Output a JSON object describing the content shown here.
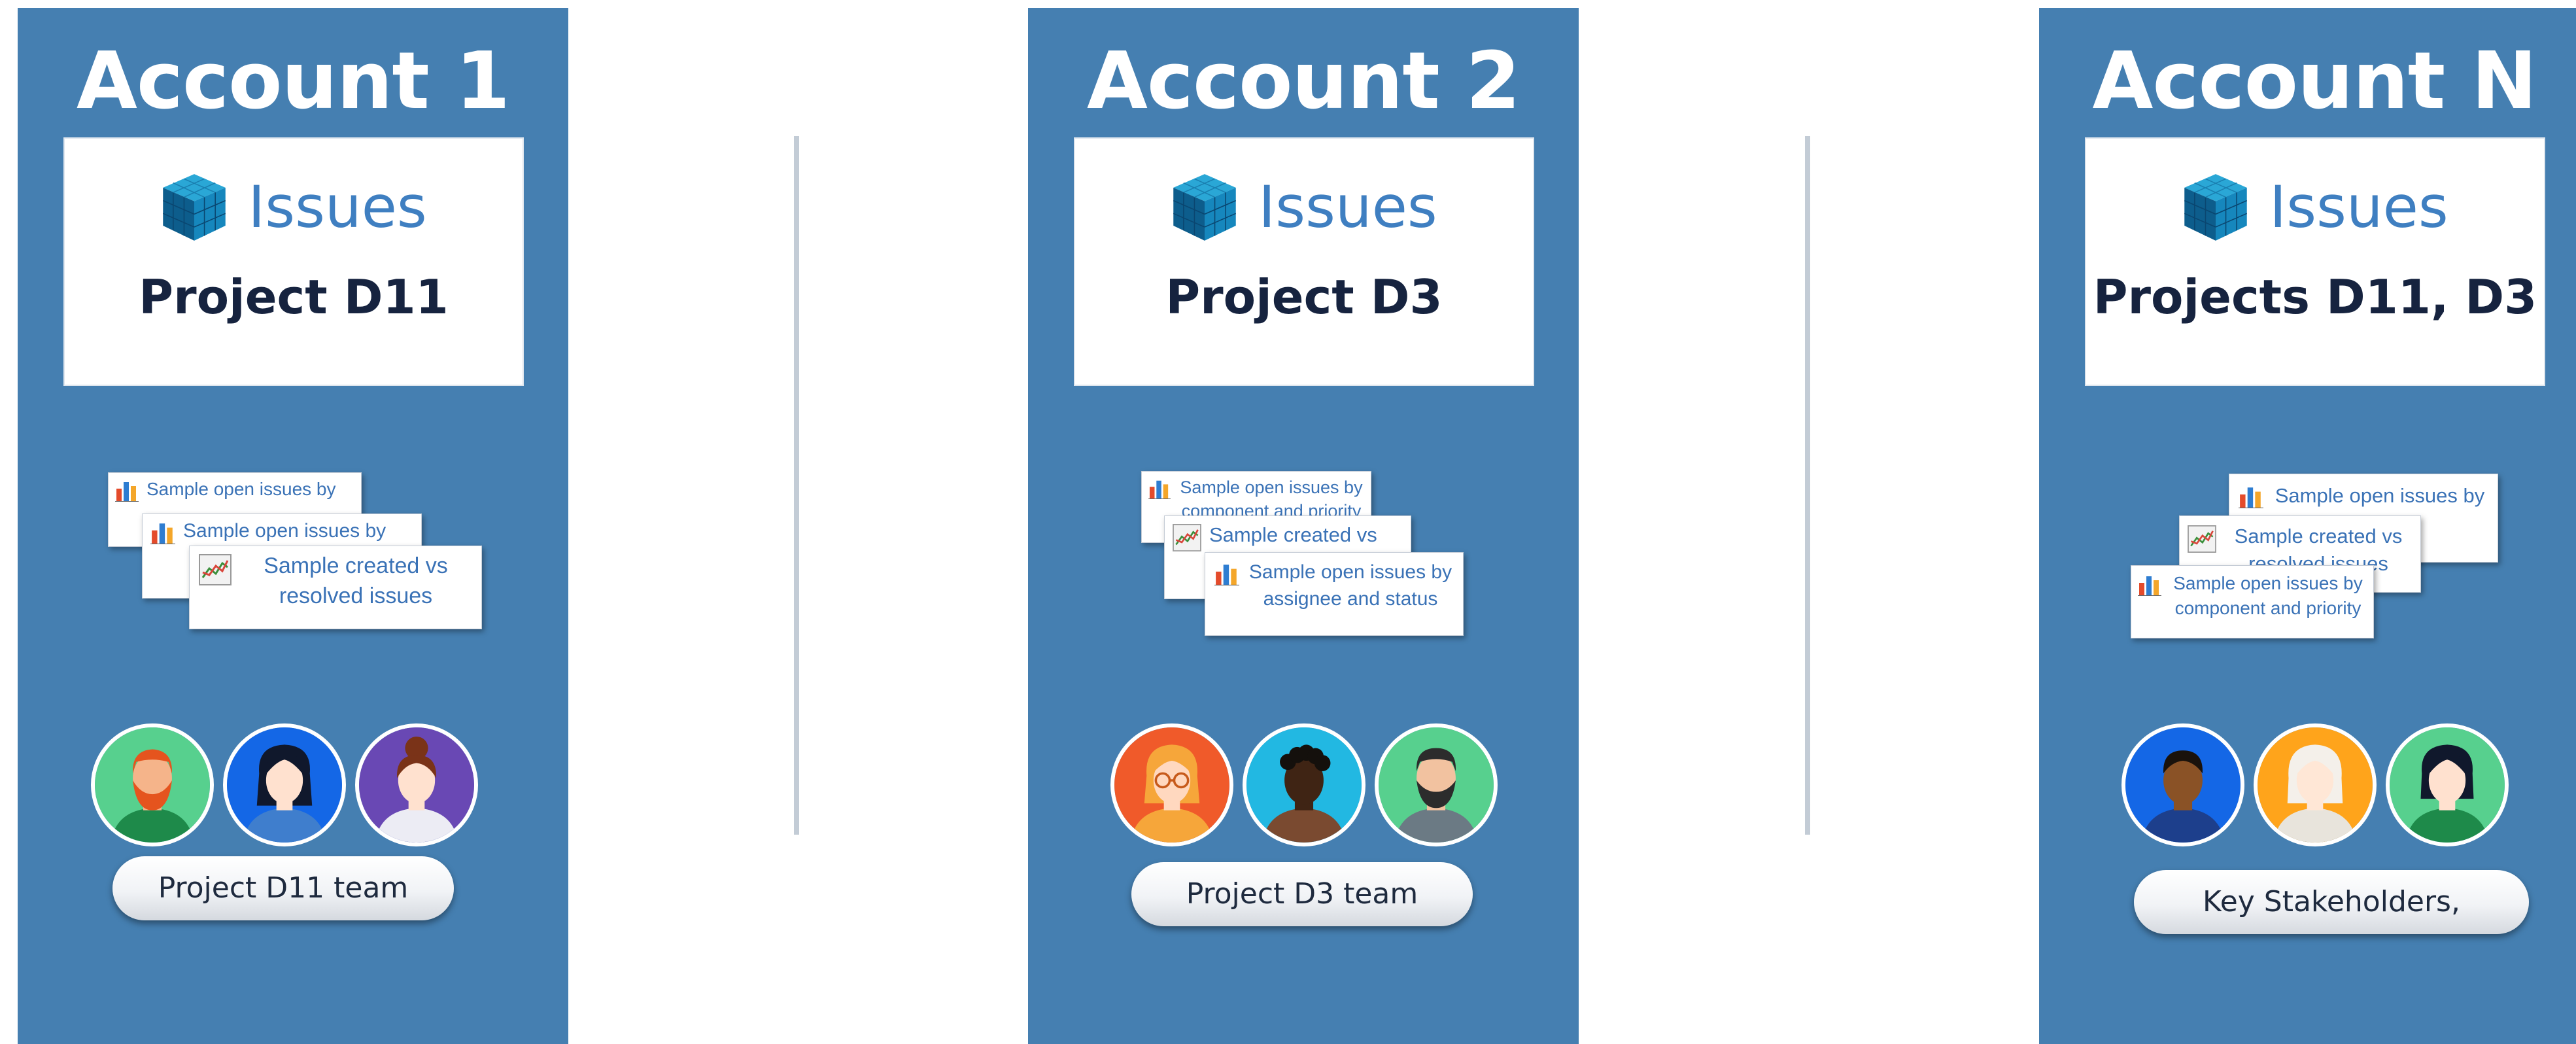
{
  "accounts": [
    {
      "title": "Account 1",
      "issues_label": "Issues",
      "project": "Project D11",
      "gadgets": [
        {
          "text": "Sample open issues by",
          "icon": "bar-chart-icon"
        },
        {
          "text": "Sample open issues by",
          "icon": "bar-chart-icon"
        },
        {
          "text": "Sample created vs resolved issues",
          "icon": "line-chart-icon"
        }
      ],
      "team_label": "Project D11 team",
      "avatars": [
        {
          "name": "avatar-red-bearded-man",
          "bg": "#57d08e",
          "skin": "#f5b48a",
          "hair": "#e5541e",
          "shirt": "#1e8a4a"
        },
        {
          "name": "avatar-dark-haired-woman",
          "bg": "#1467e6",
          "skin": "#ffe1cf",
          "hair": "#10182c",
          "shirt": "#3f7ecd"
        },
        {
          "name": "avatar-bun-haired-woman",
          "bg": "#6948b4",
          "skin": "#ffe1cf",
          "hair": "#7a3318",
          "shirt": "#ececf4"
        }
      ]
    },
    {
      "title": "Account 2",
      "issues_label": "Issues",
      "project": "Project D3",
      "gadgets": [
        {
          "text": "Sample open issues by component and priority",
          "icon": "bar-chart-icon"
        },
        {
          "text": "Sample created vs",
          "icon": "line-chart-icon"
        },
        {
          "text": "Sample open issues by assignee and status",
          "icon": "bar-chart-icon"
        }
      ],
      "team_label": "Project D3 team",
      "avatars": [
        {
          "name": "avatar-woman-glasses",
          "bg": "#f05a2a",
          "skin": "#ffd8bf",
          "hair": "#f6a63a",
          "shirt": "#f6a63a"
        },
        {
          "name": "avatar-curly-haired-man",
          "bg": "#22b8e2",
          "skin": "#3f2414",
          "hair": "#14100c",
          "shirt": "#7a4a30"
        },
        {
          "name": "avatar-bearded-man",
          "bg": "#57d08e",
          "skin": "#f2c2a0",
          "hair": "#2c2c2c",
          "shirt": "#6b7a84"
        }
      ]
    },
    {
      "title": "Account N",
      "issues_label": "Issues",
      "project": "Projects D11, D3",
      "gadgets": [
        {
          "text": "Sample open issues by status",
          "icon": "bar-chart-icon"
        },
        {
          "text": "Sample created vs resolved issues",
          "icon": "line-chart-icon"
        },
        {
          "text": "Sample open issues by component and priority",
          "icon": "bar-chart-icon"
        }
      ],
      "team_label": "Key Stakeholders,",
      "avatars": [
        {
          "name": "avatar-man",
          "bg": "#1467e6",
          "skin": "#8a5226",
          "hair": "#1a120c",
          "shirt": "#1d3f8c"
        },
        {
          "name": "avatar-white-haired-woman",
          "bg": "#ffa41b",
          "skin": "#ffe7d6",
          "hair": "#f4f0ea",
          "shirt": "#e8e4dc"
        },
        {
          "name": "avatar-woman",
          "bg": "#57d08e",
          "skin": "#ffe1cf",
          "hair": "#10182c",
          "shirt": "#1e8a4a"
        }
      ]
    }
  ],
  "colors": {
    "panel": "#457fb1",
    "issues_blue": "#3f7fc1",
    "project_text": "#16233f",
    "divider": "#c3ccd6"
  }
}
